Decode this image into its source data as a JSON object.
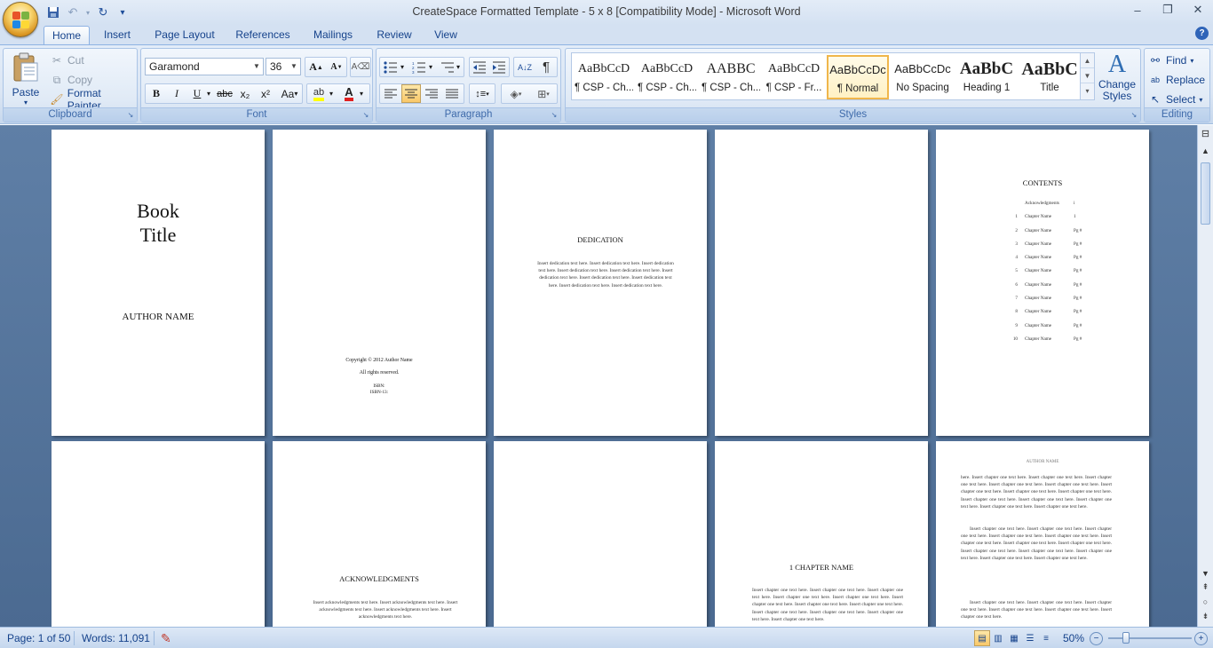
{
  "window": {
    "title": "CreateSpace Formatted Template - 5 x 8 [Compatibility Mode] - Microsoft Word",
    "controls": [
      "–",
      "❐",
      "✕"
    ]
  },
  "tabs": [
    "Home",
    "Insert",
    "Page Layout",
    "References",
    "Mailings",
    "Review",
    "View"
  ],
  "ribbon": {
    "clipboard": {
      "label": "Clipboard",
      "paste": "Paste",
      "cut": "Cut",
      "copy": "Copy",
      "format_painter": "Format Painter"
    },
    "font": {
      "label": "Font",
      "family": "Garamond",
      "size": "36",
      "bold": "B",
      "italic": "I",
      "underline": "U",
      "strike": "abc",
      "subscript": "x₂",
      "superscript": "x²",
      "change_case": "Aa"
    },
    "paragraph": {
      "label": "Paragraph"
    },
    "styles": {
      "label": "Styles",
      "items": [
        {
          "sample": "AaBbCcD",
          "name": "¶ CSP - Ch..."
        },
        {
          "sample": "AaBbCcD",
          "name": "¶ CSP - Ch..."
        },
        {
          "sample": "AABBC",
          "name": "¶ CSP - Ch..."
        },
        {
          "sample": "AaBbCcD",
          "name": "¶ CSP - Fr..."
        },
        {
          "sample": "AaBbCcDc",
          "name": "¶ Normal"
        },
        {
          "sample": "AaBbCcDc",
          "name": "No Spacing"
        },
        {
          "sample": "AaBbC",
          "name": "Heading 1"
        },
        {
          "sample": "AaBbC",
          "name": "Title"
        }
      ],
      "change_styles": "Change Styles"
    },
    "editing": {
      "label": "Editing",
      "find": "Find",
      "replace": "Replace",
      "select": "Select"
    }
  },
  "pages": {
    "title": {
      "line1": "Book",
      "line2": "Title",
      "author": "AUTHOR NAME"
    },
    "copyright": {
      "line1": "Copyright © 2012 Author Name",
      "line2": "All rights reserved.",
      "isbn": "ISBN:",
      "isbn13": "ISBN-13:"
    },
    "dedication": {
      "heading": "DEDICATION",
      "body": "Insert dedication text here. Insert dedication text here. Insert dedication text here. Insert dedication text here. Insert dedication text here. Insert dedication text here. Insert dedication text here. Insert dedication text here. Insert dedication text here. Insert dedication text here."
    },
    "contents": {
      "heading": "CONTENTS",
      "rows": [
        {
          "num": "",
          "name": "Acknowledgments",
          "pg": "i"
        },
        {
          "num": "1",
          "name": "Chapter Name",
          "pg": "1"
        },
        {
          "num": "2",
          "name": "Chapter Name",
          "pg": "Pg #"
        },
        {
          "num": "3",
          "name": "Chapter Name",
          "pg": "Pg #"
        },
        {
          "num": "4",
          "name": "Chapter Name",
          "pg": "Pg #"
        },
        {
          "num": "5",
          "name": "Chapter Name",
          "pg": "Pg #"
        },
        {
          "num": "6",
          "name": "Chapter Name",
          "pg": "Pg #"
        },
        {
          "num": "7",
          "name": "Chapter Name",
          "pg": "Pg #"
        },
        {
          "num": "8",
          "name": "Chapter Name",
          "pg": "Pg #"
        },
        {
          "num": "9",
          "name": "Chapter Name",
          "pg": "Pg #"
        },
        {
          "num": "10",
          "name": "Chapter Name",
          "pg": "Pg #"
        }
      ]
    },
    "acknowledgments": {
      "heading": "ACKNOWLEDGMENTS",
      "body": "Insert acknowledgments text here. Insert acknowledgments text here. Insert acknowledgments text here. Insert acknowledgments text here. Insert acknowledgments text here."
    },
    "chapter": {
      "heading": "1 CHAPTER NAME",
      "body": "Insert chapter one text here. Insert chapter one text here. Insert chapter one text here. Insert chapter one text here. Insert chapter one text here. Insert chapter one text here. Insert chapter one text here. Insert chapter one text here. Insert chapter one text here. Insert chapter one text here. Insert chapter one text here. Insert chapter one text here."
    },
    "running": {
      "header": "AUTHOR NAME",
      "p1": "here. Insert chapter one text here. Insert chapter one text here. Insert chapter one text here. Insert chapter one text here. Insert chapter one text here. Insert chapter one text here. Insert chapter one text here. Insert chapter one text here. Insert chapter one text here. Insert chapter one text here. Insert chapter one text here. Insert chapter one text here. Insert chapter one text here.",
      "p2": "Insert chapter one text here. Insert chapter one text here. Insert chapter one text here. Insert chapter one text here. Insert chapter one text here. Insert chapter one text here. Insert chapter one text here. Insert chapter one text here. Insert chapter one text here. Insert chapter one text here. Insert chapter one text here. Insert chapter one text here. Insert chapter one text here.",
      "p3": "Insert chapter one text here. Insert chapter one text here. Insert chapter one text here. Insert chapter one text here. Insert chapter one text here. Insert chapter one text here."
    }
  },
  "status": {
    "page": "Page: 1 of 50",
    "words": "Words: 11,091",
    "zoom": "50%"
  }
}
